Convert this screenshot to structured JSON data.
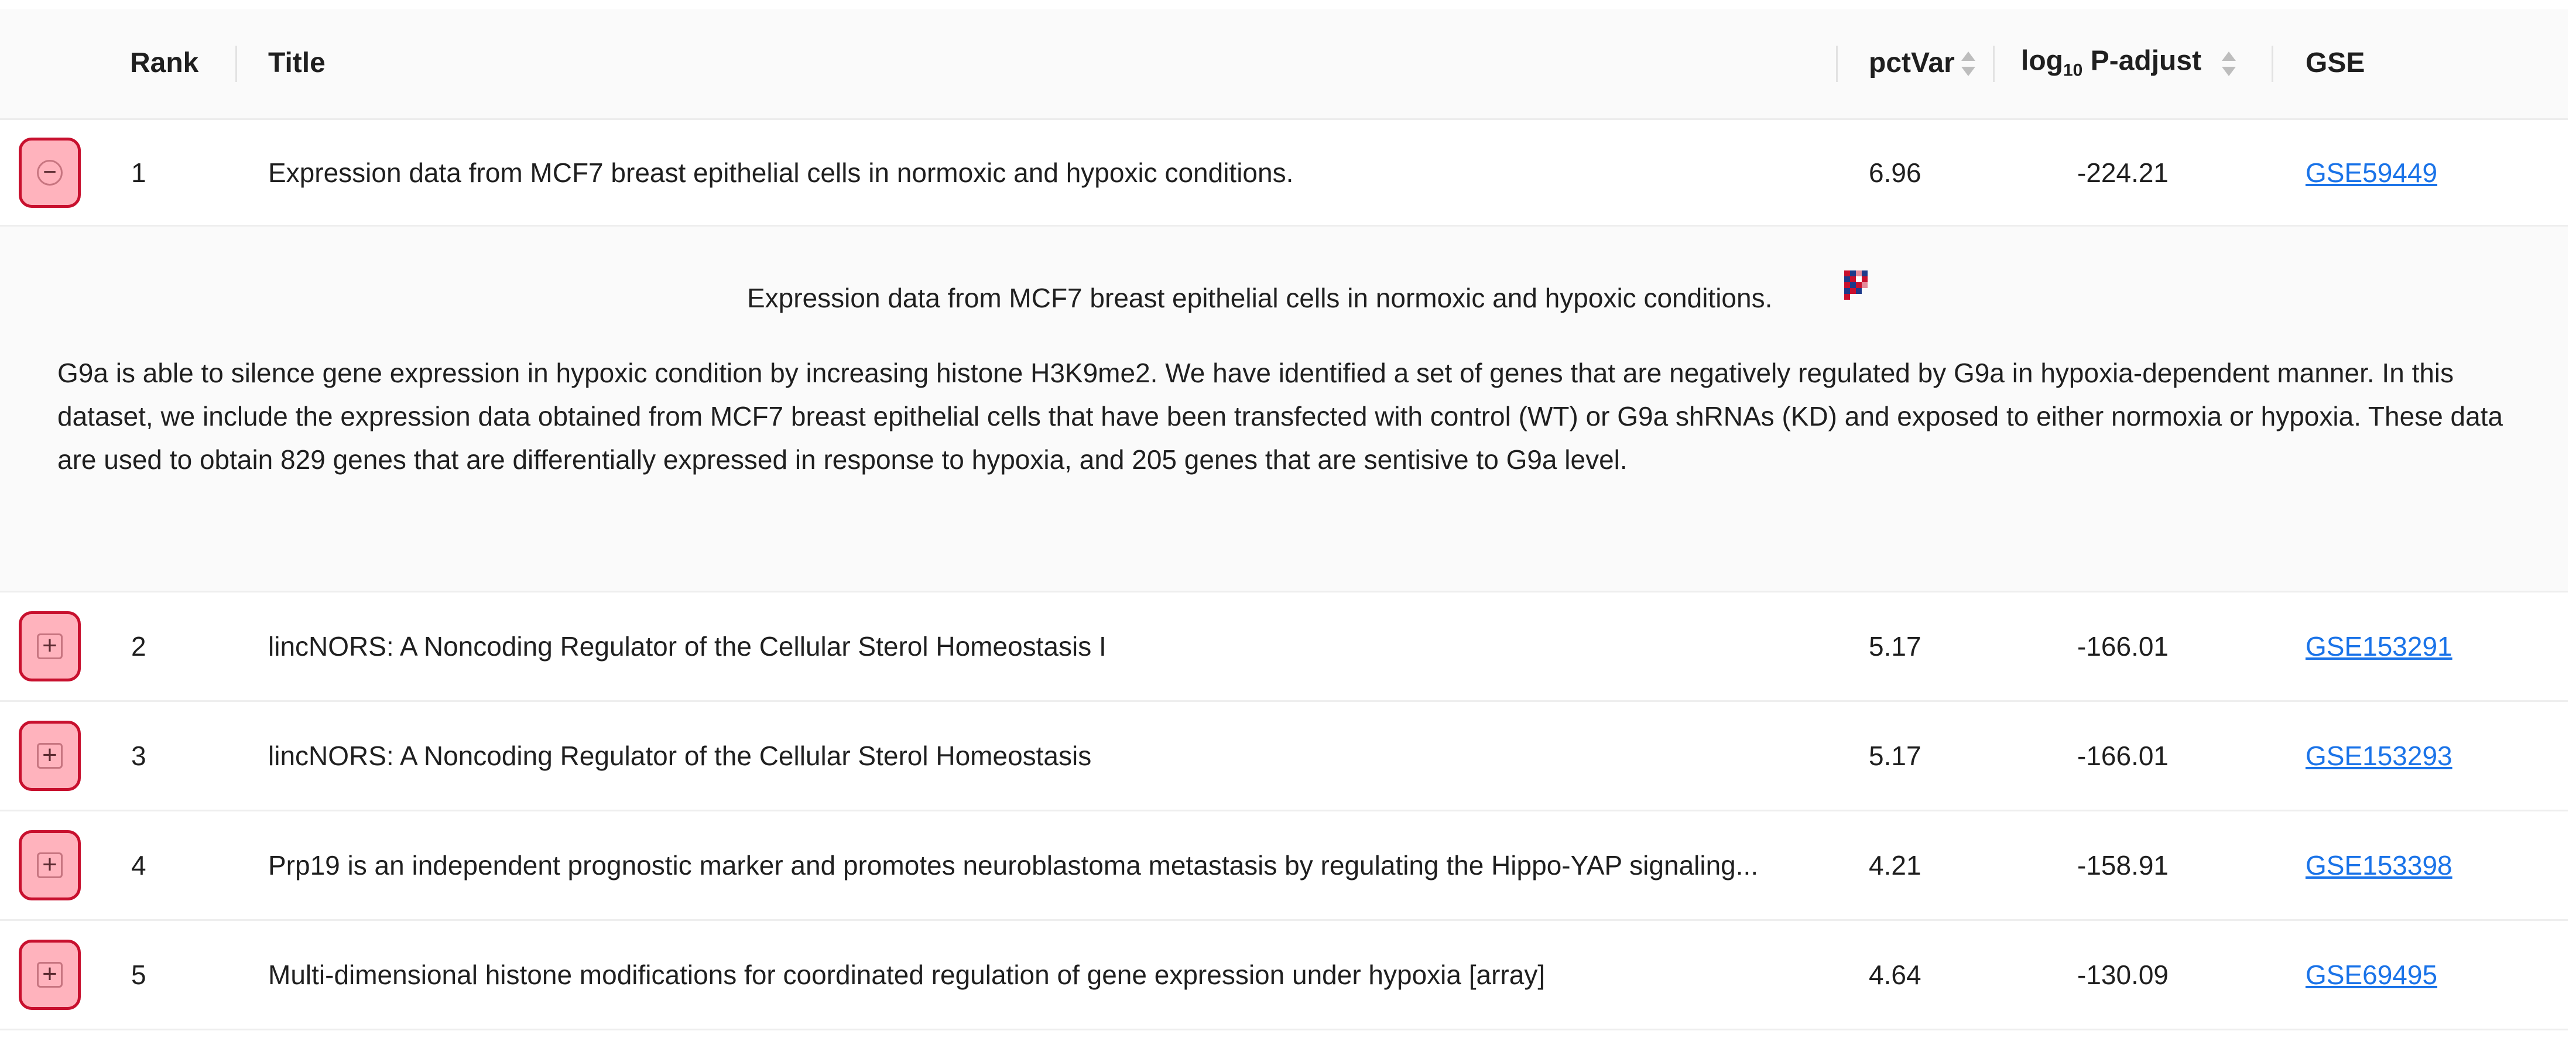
{
  "table": {
    "headers": {
      "rank": "Rank",
      "title": "Title",
      "pctvar": "pctVar",
      "log_prefix": "log",
      "log_sub": "10",
      "log_suffix": " P-adjust",
      "gse": "GSE"
    },
    "rows": [
      {
        "rank": "1",
        "title": "Expression data from MCF7 breast epithelial cells in normoxic and hypoxic conditions.",
        "pctvar": "6.96",
        "padj": "-224.21",
        "gse": "GSE59449",
        "toggle": "−"
      },
      {
        "rank": "2",
        "title": "lincNORS: A Noncoding Regulator of the Cellular Sterol Homeostasis I",
        "pctvar": "5.17",
        "padj": "-166.01",
        "gse": "GSE153291",
        "toggle": "+"
      },
      {
        "rank": "3",
        "title": "lincNORS: A Noncoding Regulator of the Cellular Sterol Homeostasis",
        "pctvar": "5.17",
        "padj": "-166.01",
        "gse": "GSE153293",
        "toggle": "+"
      },
      {
        "rank": "4",
        "title": "Prp19 is an independent prognostic marker and promotes neuroblastoma metastasis by regulating the Hippo-YAP signaling...",
        "pctvar": "4.21",
        "padj": "-158.91",
        "gse": "GSE153398",
        "toggle": "+"
      },
      {
        "rank": "5",
        "title": "Multi-dimensional histone modifications for coordinated regulation of gene expression under hypoxia [array]",
        "pctvar": "4.64",
        "padj": "-130.09",
        "gse": "GSE69495",
        "toggle": "+"
      }
    ],
    "expanded": {
      "title": "Expression data from MCF7 breast epithelial cells in normoxic and hypoxic conditions.",
      "thumbnail_icon": "heatmap-thumbnail-icon",
      "description": "G9a is able to silence gene expression in hypoxic condition by increasing histone H3K9me2. We have identified a set of genes that are negatively regulated by G9a in hypoxia-dependent manner. In this dataset, we include the expression data obtained from MCF7 breast epithelial cells that have been transfected with control (WT) or G9a shRNAs (KD) and exposed to either normoxia or hypoxia. These data are used to obtain 829 genes that are differentially expressed in response to hypoxia, and 205 genes that are sentisive to G9a level."
    }
  },
  "colors": {
    "link": "#1a73e8",
    "toggle_border": "#c8102e",
    "toggle_fill": "#ffb3bd",
    "header_bg": "#fafafa"
  }
}
